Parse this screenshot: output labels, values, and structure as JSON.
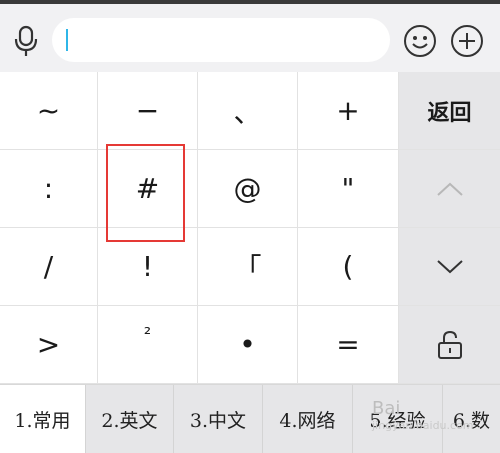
{
  "input": {
    "value": "",
    "placeholder": ""
  },
  "top_icons": {
    "mic": "microphone-icon",
    "emoji": "smiley-icon",
    "plus": "plus-circle-icon"
  },
  "keys": [
    [
      "~",
      "−",
      "、",
      "+",
      "返回"
    ],
    [
      ":",
      "#",
      "@",
      "\"",
      "▲"
    ],
    [
      "/",
      "!",
      "「",
      "(",
      "▼"
    ],
    [
      ">",
      "²",
      "•",
      "=",
      "lock"
    ]
  ],
  "tabs": [
    "1.常用",
    "2.英文",
    "3.中文",
    "4.网络",
    "5.经验",
    "6.数"
  ],
  "watermark": {
    "line1": "Bai",
    "line2": "jingyan.baidu.com"
  },
  "colors": {
    "highlight": "#e53935",
    "caret": "#2fb6e8"
  }
}
